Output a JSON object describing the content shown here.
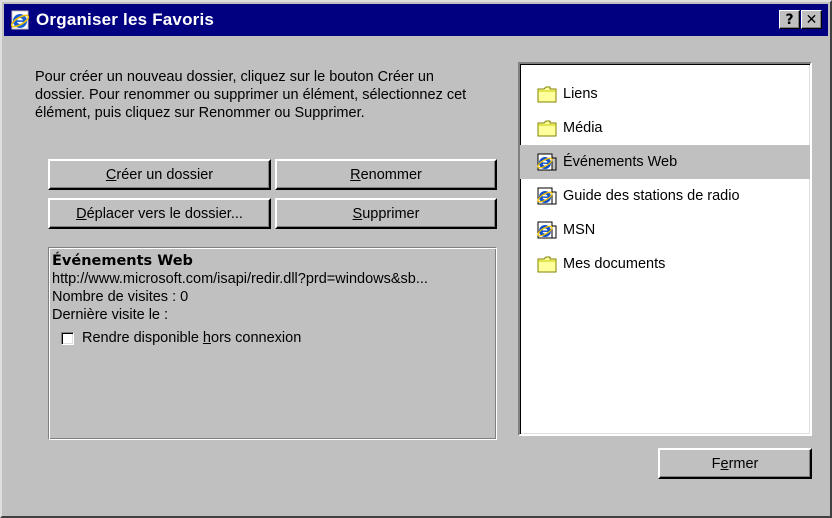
{
  "window": {
    "title": "Organiser les Favoris",
    "help_label": "?",
    "close_label": "✕"
  },
  "instructions": "Pour créer un nouveau dossier, cliquez sur le bouton Créer un dossier. Pour renommer ou supprimer un élément, sélectionnez cet élément, puis cliquez sur Renommer ou Supprimer.",
  "buttons": {
    "create_folder": {
      "pre": "",
      "key": "C",
      "post": "réer un dossier"
    },
    "rename": {
      "pre": "",
      "key": "R",
      "post": "enommer"
    },
    "move_to_folder": {
      "pre": "",
      "key": "D",
      "post": "éplacer vers le dossier..."
    },
    "delete": {
      "pre": "",
      "key": "S",
      "post": "upprimer"
    },
    "close": {
      "pre": "F",
      "key": "e",
      "post": "rmer"
    }
  },
  "details": {
    "name": "Événements Web",
    "url": "http://www.microsoft.com/isapi/redir.dll?prd=windows&sb...",
    "visits": "Nombre de visites : 0",
    "last_visit": "Dernière visite le :",
    "offline_pre": "Rendre disponible ",
    "offline_key": "h",
    "offline_post": "ors connexion"
  },
  "favorites": [
    {
      "label": "Liens",
      "icon": "folder-icon",
      "selected": false
    },
    {
      "label": "Média",
      "icon": "folder-icon",
      "selected": false
    },
    {
      "label": "Événements Web",
      "icon": "ie-link-icon",
      "selected": true
    },
    {
      "label": "Guide des stations de radio",
      "icon": "ie-link-icon",
      "selected": false
    },
    {
      "label": "MSN",
      "icon": "ie-link-icon",
      "selected": false
    },
    {
      "label": "Mes documents",
      "icon": "folder-icon",
      "selected": false
    }
  ],
  "colors": {
    "titlebar": "#000080",
    "face": "#c0c0c0",
    "folder": "#ffff9c"
  }
}
